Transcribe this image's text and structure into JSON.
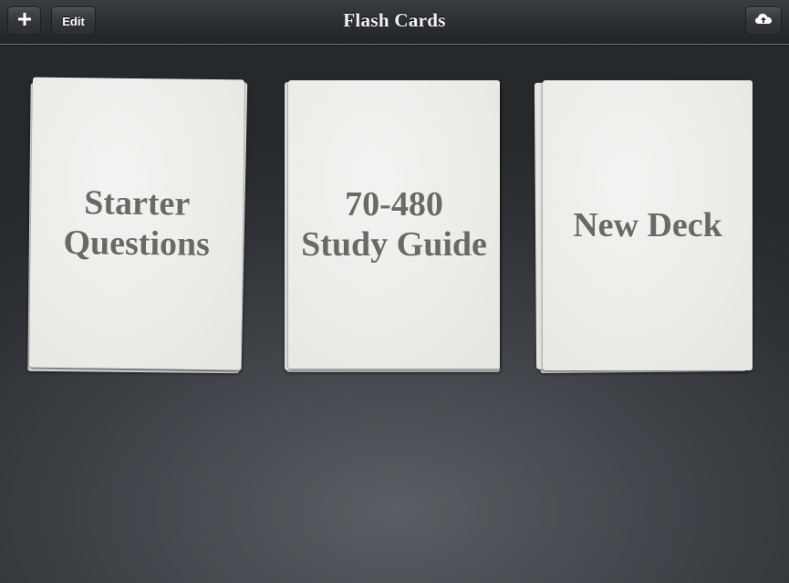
{
  "navbar": {
    "title": "Flash Cards",
    "add_icon": "plus-icon",
    "edit_label": "Edit",
    "sync_icon": "cloud-sync-icon"
  },
  "decks": [
    {
      "title": "Starter Questions"
    },
    {
      "title": "70-480 Study Guide"
    },
    {
      "title": "New Deck"
    }
  ],
  "colors": {
    "background": "#33363a",
    "card": "#ededeb",
    "card_text": "#6a6966",
    "nav_title": "#f2f2f2"
  }
}
